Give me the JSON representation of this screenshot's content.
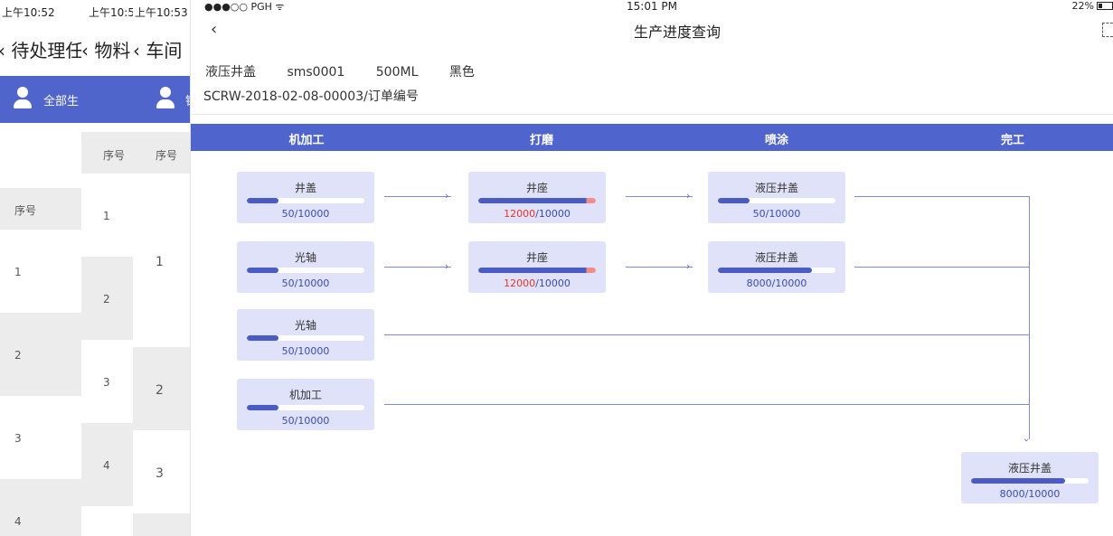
{
  "panels": {
    "p1": {
      "time": "上午10:52",
      "title": "‹ 待处理任",
      "bar_label": "全部生",
      "rows": [
        {
          "text": "序号"
        },
        {
          "text": "1"
        },
        {
          "text": "2"
        },
        {
          "text": "3"
        },
        {
          "text": "4"
        }
      ]
    },
    "p2": {
      "time": "上午10:5",
      "title": "‹ 物料",
      "rows": [
        {
          "text": "序号"
        },
        {
          "text": "1"
        },
        {
          "text": "2"
        },
        {
          "text": "3"
        },
        {
          "text": "4"
        }
      ]
    },
    "p3": {
      "time": "上午10:53",
      "title": "‹ 车间",
      "bar_label": "银",
      "rows": [
        {
          "text": "序号"
        },
        {
          "text": "1"
        },
        {
          "text": "2"
        },
        {
          "text": "3"
        }
      ]
    }
  },
  "main": {
    "status": {
      "carrier": "●●●○○ PGH",
      "wifi": "ᯤ",
      "time": "15:01 PM",
      "battery": "22%"
    },
    "back_icon": "‹",
    "title": "生产进度查询",
    "info": {
      "product": "液压井盖",
      "code": "sms0001",
      "volume": "500ML",
      "color": "黑色",
      "order": "SCRW-2018-02-08-00003/订单编号"
    },
    "stages": [
      "机加工",
      "打磨",
      "喷涂",
      "完工"
    ],
    "nodes": [
      {
        "name": "井盖",
        "done": "50",
        "total": "/10000",
        "progress": 0.27,
        "over": false
      },
      {
        "name": "井座",
        "done": "12000",
        "total": "/10000",
        "progress": 1.0,
        "over": true
      },
      {
        "name": "液压井盖",
        "done": "50",
        "total": "/10000",
        "progress": 0.27,
        "over": false
      },
      {
        "name": "光轴",
        "done": "50",
        "total": "/10000",
        "progress": 0.27,
        "over": false
      },
      {
        "name": "井座",
        "done": "12000",
        "total": "/10000",
        "progress": 1.0,
        "over": true
      },
      {
        "name": "液压井盖",
        "done": "8000",
        "total": "/10000",
        "progress": 0.8,
        "over": false
      },
      {
        "name": "光轴",
        "done": "50",
        "total": "/10000",
        "progress": 0.27,
        "over": false
      },
      {
        "name": "机加工",
        "done": "50",
        "total": "/10000",
        "progress": 0.27,
        "over": false
      },
      {
        "name": "液压井盖",
        "done": "8000",
        "total": "/10000",
        "progress": 0.8,
        "over": false
      }
    ],
    "colors": {
      "stage_bar": "#4f64cc",
      "node_bg": "#dfe2f8",
      "progress": "#4a5cc4",
      "over": "#f28d8d",
      "over_text": "#e8332a"
    }
  }
}
